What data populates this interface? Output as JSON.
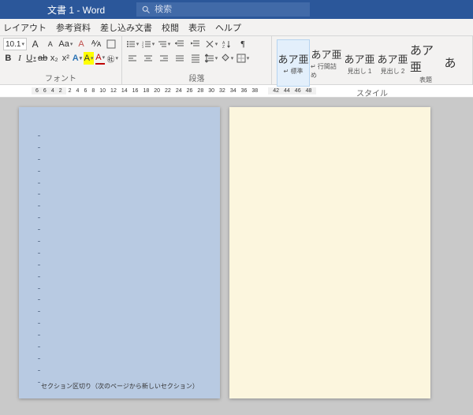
{
  "title": "文書 1  -  Word",
  "search": {
    "placeholder": "検索"
  },
  "tabs": [
    "レイアウト",
    "参考資料",
    "差し込み文書",
    "校閲",
    "表示",
    "ヘルプ"
  ],
  "font": {
    "size_value": "10.1",
    "ruby": "ᴬ⁄ᴀ",
    "clear": "A",
    "case": "Aa",
    "bold": "B",
    "italic": "I",
    "underline": "U",
    "strike": "ab",
    "sub": "x₂",
    "sup": "x²",
    "effects": "A",
    "highlight": "A",
    "color": "A",
    "group_label": "フォント",
    "grow": "A",
    "shrink": "A"
  },
  "para": {
    "group_label": "段落",
    "bullet": "•",
    "number": "1.",
    "multi": "≡",
    "outdent": "⇤",
    "indent": "⇥",
    "sort": "A↓",
    "marks": "¶",
    "alignL": "≡",
    "alignC": "≡",
    "alignR": "≡",
    "alignJ": "≡",
    "spacing": "↕",
    "shading": "▦",
    "border": "▭"
  },
  "styles": {
    "group_label": "スタイル",
    "items": [
      {
        "sample": "あア亜",
        "name": "標準",
        "sub": "↵ 標準"
      },
      {
        "sample": "あア亜",
        "name": "行間詰め",
        "sub": "↵ 行間詰め"
      },
      {
        "sample": "あア亜",
        "name": "見出し 1",
        "sub": "見出し 1"
      },
      {
        "sample": "あア亜",
        "name": "見出し 2",
        "sub": "見出し 2"
      },
      {
        "sample": "あア亜",
        "name": "表題",
        "sub": "表題"
      },
      {
        "sample": "あ",
        "name": "",
        "sub": ""
      }
    ]
  },
  "ruler_left_ticks": [
    "6",
    "6",
    "4",
    "2"
  ],
  "ruler_main_ticks": [
    "2",
    "4",
    "6",
    "8",
    "10",
    "12",
    "14",
    "16",
    "18",
    "20",
    "22",
    "24",
    "26",
    "28",
    "30",
    "32",
    "34",
    "36",
    "38"
  ],
  "ruler_right_ticks": [
    "42",
    "44",
    "46",
    "48"
  ],
  "section_break_text": "セクション区切り（次のページから新しいセクション）"
}
